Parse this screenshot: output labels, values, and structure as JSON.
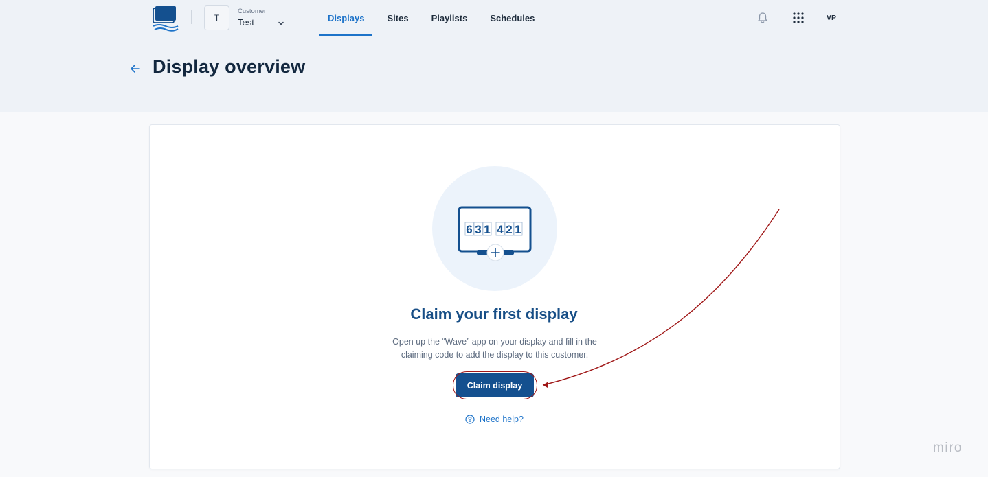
{
  "header": {
    "customer_badge": "T",
    "customer_caption": "Customer",
    "customer_name": "Test",
    "nav": [
      {
        "label": "Displays",
        "active": true
      },
      {
        "label": "Sites",
        "active": false
      },
      {
        "label": "Playlists",
        "active": false
      },
      {
        "label": "Schedules",
        "active": false
      }
    ],
    "avatar_initials": "VP",
    "icons": {
      "logo": "displays-logo-icon",
      "chevron": "chevron-down-icon",
      "notifications": "bell-icon",
      "apps": "app-grid-icon"
    }
  },
  "page": {
    "title": "Display overview",
    "back_icon": "back-arrow-icon"
  },
  "empty_state": {
    "illustration_code": "631421",
    "title": "Claim your first display",
    "description": "Open up the “Wave” app on your display and fill in the claiming code to add the display to this customer.",
    "button_label": "Claim display",
    "help_label": "Need help?"
  },
  "watermark": "miro",
  "colors": {
    "accent": "#1d73c9",
    "primary_button": "#14508f",
    "title_blue": "#174e86",
    "annotation": "#a01818",
    "header_band": "#eef2f7"
  }
}
